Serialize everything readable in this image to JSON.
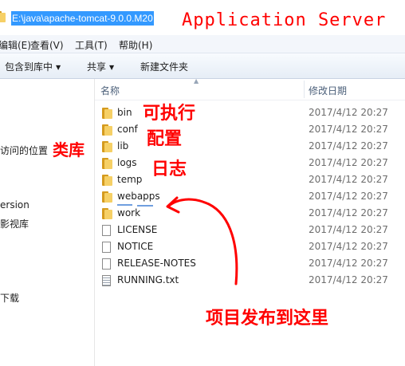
{
  "address": {
    "path": "E:\\java\\apache-tomcat-9.0.0.M20"
  },
  "menu": {
    "items": [
      "编辑(E)",
      "查看(V)",
      "工具(T)",
      "帮助(H)"
    ]
  },
  "toolbar": {
    "include_library": "包含到库中",
    "share": "共享",
    "new_folder": "新建文件夹"
  },
  "nav": {
    "items": [
      "访问的位置",
      "ersion",
      "影视库",
      "下载"
    ]
  },
  "columns": {
    "name": "名称",
    "date_modified": "修改日期"
  },
  "files": [
    {
      "name": "bin",
      "type": "folder",
      "date": "2017/4/12 20:27"
    },
    {
      "name": "conf",
      "type": "folder",
      "date": "2017/4/12 20:27"
    },
    {
      "name": "lib",
      "type": "folder",
      "date": "2017/4/12 20:27"
    },
    {
      "name": "logs",
      "type": "folder",
      "date": "2017/4/12 20:27"
    },
    {
      "name": "temp",
      "type": "folder",
      "date": "2017/4/12 20:27"
    },
    {
      "name": "webapps",
      "type": "folder",
      "date": "2017/4/12 20:27"
    },
    {
      "name": "work",
      "type": "folder",
      "date": "2017/4/12 20:27"
    },
    {
      "name": "LICENSE",
      "type": "file",
      "date": "2017/4/12 20:27"
    },
    {
      "name": "NOTICE",
      "type": "file",
      "date": "2017/4/12 20:27"
    },
    {
      "name": "RELEASE-NOTES",
      "type": "file",
      "date": "2017/4/12 20:27"
    },
    {
      "name": "RUNNING.txt",
      "type": "text-file",
      "date": "2017/4/12 20:27"
    }
  ],
  "annotations": {
    "title": "Application Server",
    "executable": "可执行",
    "config": "配置",
    "log": "日志",
    "library": "类库",
    "deploy": "项目发布到这里",
    "color": "#ff0000"
  },
  "colors": {
    "selection": "#3399ff",
    "folder": "#f6d066"
  }
}
